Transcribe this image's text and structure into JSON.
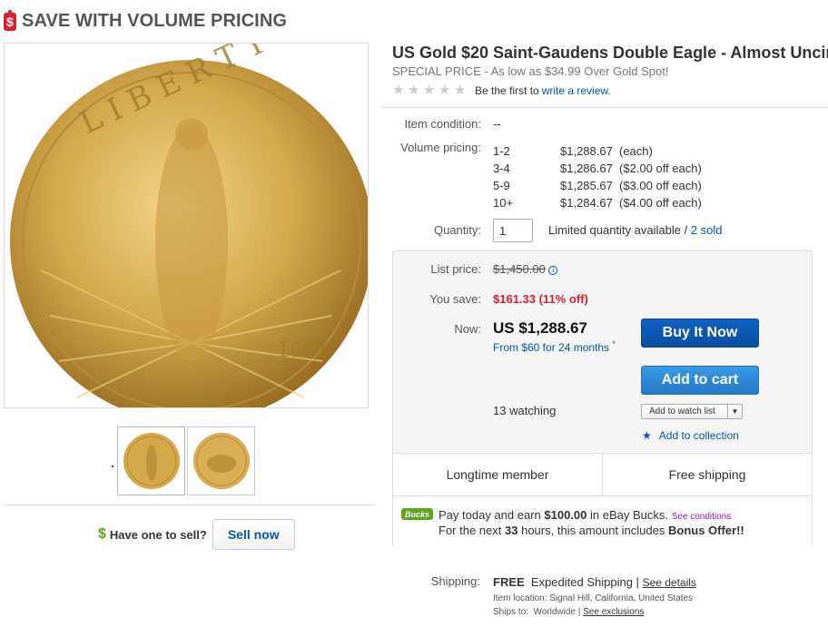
{
  "banner": {
    "icon_glyph": "$",
    "title": "SAVE WITH VOLUME PRICING"
  },
  "listing": {
    "title": "US Gold $20 Saint-Gaudens Double Eagle - Almost Uncir",
    "subtitle": "SPECIAL PRICE - As low as $34.99 Over Gold Spot!",
    "rating_text": "Be the first to",
    "review_link": "write a review."
  },
  "details": {
    "condition_label": "Item condition:",
    "condition_value": "--",
    "volume_label": "Volume pricing:",
    "volume": [
      {
        "qty": "1-2",
        "price": "$1,288.67",
        "note": "(each)"
      },
      {
        "qty": "3-4",
        "price": "$1,286.67",
        "note": "($2.00 off each)"
      },
      {
        "qty": "5-9",
        "price": "$1,285.67",
        "note": "($3.00 off each)"
      },
      {
        "qty": "10+",
        "price": "$1,284.67",
        "note": "($4.00 off each)"
      }
    ],
    "quantity_label": "Quantity:",
    "quantity_value": "1",
    "quantity_info": "Limited quantity available /",
    "sold_link": "2 sold"
  },
  "pricing": {
    "list_label": "List price:",
    "list_price": "$1,450.00",
    "save_label": "You save:",
    "save_value": "$161.33 (11% off)",
    "now_label": "Now:",
    "now_price": "US $1,288.67",
    "finance_link": "From $60 for 24 months",
    "finance_mark": "*",
    "buy_now": "Buy It Now",
    "add_to_cart": "Add to cart",
    "watching": "13 watching",
    "watch_list": "Add to watch list",
    "add_collection": "Add to collection",
    "longtime": "Longtime member",
    "free_shipping": "Free shipping"
  },
  "bucks": {
    "badge": "Bucks",
    "line1_pre": "Pay today and earn",
    "line1_amount": "$100.00",
    "line1_post": "in eBay Bucks.",
    "see_conditions": "See conditions",
    "line2_pre": "For the next",
    "line2_hours": "33",
    "line2_mid": "hours, this amount includes",
    "line2_bold": "Bonus Offer!!"
  },
  "shipping": {
    "label": "Shipping:",
    "free": "FREE",
    "method": "Expedited Shipping |",
    "see_details": "See details",
    "location": "Item location:  Signal Hill, California, United States",
    "ships_to_label": "Ships to:",
    "ships_to_value": "Worldwide |",
    "see_exclusions": "See exclusions"
  },
  "sell": {
    "icon_glyph": "$",
    "prompt": "Have one to sell?",
    "button": "Sell now"
  },
  "colors": {
    "accent_blue": "#0654ba",
    "sale_red": "#dd1e31",
    "bucks_green": "#5ba71b",
    "gold": "#d4a84b"
  }
}
